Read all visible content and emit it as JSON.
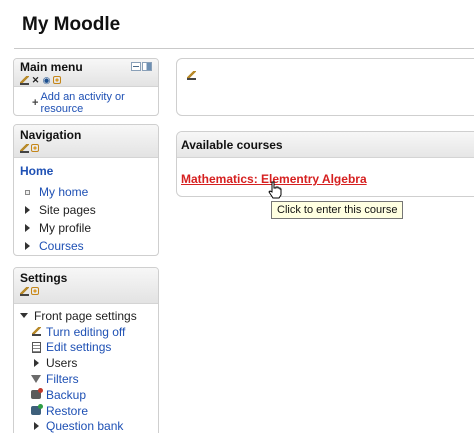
{
  "site": {
    "title": "My Moodle"
  },
  "main_menu": {
    "title": "Main menu",
    "add_link": "Add an activity or resource"
  },
  "navigation": {
    "title": "Navigation",
    "home": "Home",
    "items": [
      {
        "label": "My home",
        "type": "link",
        "marker": "square"
      },
      {
        "label": "Site pages",
        "type": "plain",
        "marker": "collapsed"
      },
      {
        "label": "My profile",
        "type": "plain",
        "marker": "collapsed"
      },
      {
        "label": "Courses",
        "type": "link",
        "marker": "collapsed"
      }
    ]
  },
  "settings": {
    "title": "Settings",
    "section": "Front page settings",
    "items": [
      {
        "label": "Turn editing off",
        "icon": "edit-icon"
      },
      {
        "label": "Edit settings",
        "icon": "document-icon"
      },
      {
        "label": "Users",
        "icon": "expand-arrow-icon"
      },
      {
        "label": "Filters",
        "icon": "filter-icon"
      },
      {
        "label": "Backup",
        "icon": "backup-icon"
      },
      {
        "label": "Restore",
        "icon": "restore-icon"
      },
      {
        "label": "Question bank",
        "icon": "expand-arrow-icon"
      }
    ]
  },
  "available_courses": {
    "title": "Available courses",
    "courses": [
      "Mathematics: Elementry Algebra"
    ]
  },
  "tooltip": {
    "text": "Click to enter this course"
  },
  "colors": {
    "link": "#1e50b4",
    "course_link": "#d62020",
    "tooltip_bg": "#ffffe1"
  }
}
